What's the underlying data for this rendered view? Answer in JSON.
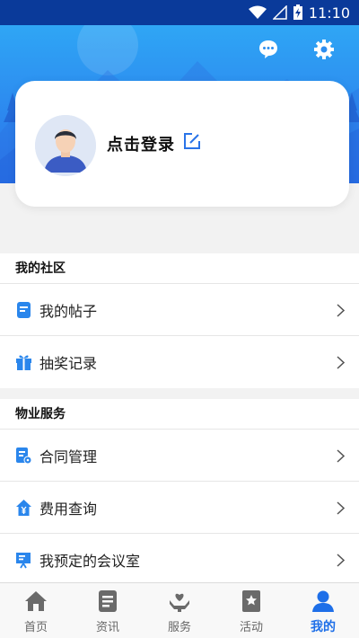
{
  "status_bar": {
    "time": "11:10",
    "icons": [
      "wifi-icon",
      "signal-icon",
      "battery-charging-icon"
    ]
  },
  "header": {
    "chat_icon": "chat-bubble-icon",
    "settings_icon": "gear-icon"
  },
  "profile": {
    "login_label": "点击登录",
    "edit_icon": "edit-icon",
    "avatar": "avatar-icon"
  },
  "community": {
    "title": "我的社区",
    "items": [
      {
        "label": "我的帖子",
        "icon": "document-icon"
      },
      {
        "label": "抽奖记录",
        "icon": "gift-icon"
      }
    ]
  },
  "property": {
    "title": "物业服务",
    "items": [
      {
        "label": "合同管理",
        "icon": "contract-icon"
      },
      {
        "label": "费用查询",
        "icon": "fee-house-icon"
      },
      {
        "label": "我预定的会议室",
        "icon": "meeting-room-icon"
      }
    ]
  },
  "tabs": [
    {
      "label": "首页",
      "icon": "home-icon"
    },
    {
      "label": "资讯",
      "icon": "news-icon"
    },
    {
      "label": "服务",
      "icon": "service-icon"
    },
    {
      "label": "活动",
      "icon": "activity-icon"
    },
    {
      "label": "我的",
      "icon": "user-icon",
      "active": true
    }
  ],
  "colors": {
    "accent": "#1e6fe8",
    "header_top": "#2fa6f5",
    "header_bottom": "#2a72ea",
    "tab_inactive": "#666666"
  }
}
